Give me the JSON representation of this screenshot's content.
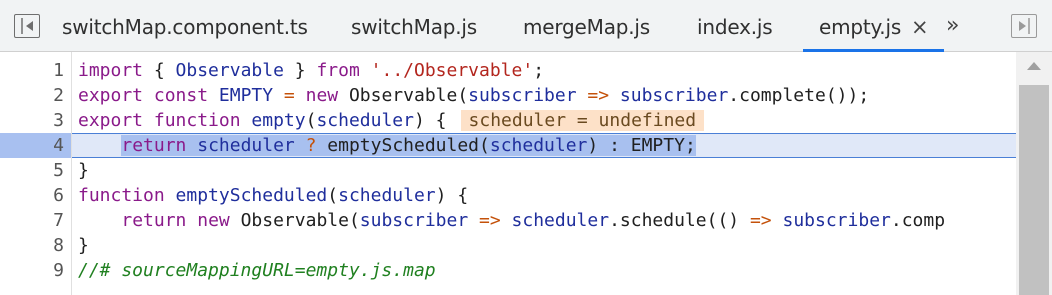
{
  "tabs": [
    {
      "label": "switchMap.component.ts",
      "active": false
    },
    {
      "label": "switchMap.js",
      "active": false
    },
    {
      "label": "mergeMap.js",
      "active": false
    },
    {
      "label": "index.js",
      "active": false
    },
    {
      "label": "empty.js",
      "active": true
    }
  ],
  "tab_close_glyph": "×",
  "more_tabs_glyph": "»",
  "icons": {
    "left_toggle": "toggle-navigator-icon",
    "right_toggle": "toggle-debugger-icon"
  },
  "colors": {
    "keyword": "#8a1a8a",
    "string": "#b3261e",
    "variable": "#1f2e9c",
    "comment": "#208020",
    "execution_line": "#e0e8f8",
    "accent": "#1a73e8"
  },
  "editor": {
    "line_numbers": [
      "1",
      "2",
      "3",
      "4",
      "5",
      "6",
      "7",
      "8",
      "9"
    ],
    "execution_line": 4,
    "lines": [
      [
        {
          "t": "import",
          "c": "k"
        },
        {
          "t": " { "
        },
        {
          "t": "Observable",
          "c": "v"
        },
        {
          "t": " } "
        },
        {
          "t": "from",
          "c": "k"
        },
        {
          "t": " "
        },
        {
          "t": "'../Observable'",
          "c": "s"
        },
        {
          "t": ";"
        }
      ],
      [
        {
          "t": "export",
          "c": "k"
        },
        {
          "t": " "
        },
        {
          "t": "const",
          "c": "k"
        },
        {
          "t": " "
        },
        {
          "t": "EMPTY",
          "c": "v"
        },
        {
          "t": " = ",
          "c": "o"
        },
        {
          "t": "new",
          "c": "k"
        },
        {
          "t": " Observable("
        },
        {
          "t": "subscriber",
          "c": "v"
        },
        {
          "t": " => ",
          "c": "o"
        },
        {
          "t": "subscriber",
          "c": "v"
        },
        {
          "t": ".complete());"
        }
      ],
      [
        {
          "t": "export",
          "c": "k"
        },
        {
          "t": " "
        },
        {
          "t": "function",
          "c": "k"
        },
        {
          "t": " "
        },
        {
          "t": "empty",
          "c": "v"
        },
        {
          "t": "("
        },
        {
          "t": "scheduler",
          "c": "v"
        },
        {
          "t": ") {"
        }
      ],
      [
        {
          "t": "    "
        },
        {
          "t": "return",
          "c": "k"
        },
        {
          "t": " "
        },
        {
          "t": "scheduler",
          "c": "v"
        },
        {
          "t": " ? ",
          "c": "o"
        },
        {
          "t": "emptyScheduled("
        },
        {
          "t": "scheduler",
          "c": "v"
        },
        {
          "t": ") : EMPTY;"
        }
      ],
      [
        {
          "t": "}"
        }
      ],
      [
        {
          "t": "function",
          "c": "k"
        },
        {
          "t": " "
        },
        {
          "t": "emptyScheduled",
          "c": "v"
        },
        {
          "t": "("
        },
        {
          "t": "scheduler",
          "c": "v"
        },
        {
          "t": ") {"
        }
      ],
      [
        {
          "t": "    "
        },
        {
          "t": "return",
          "c": "k"
        },
        {
          "t": " "
        },
        {
          "t": "new",
          "c": "k"
        },
        {
          "t": " Observable("
        },
        {
          "t": "subscriber",
          "c": "v"
        },
        {
          "t": " => ",
          "c": "o"
        },
        {
          "t": "scheduler",
          "c": "v"
        },
        {
          "t": ".schedule(() "
        },
        {
          "t": "=>",
          "c": "o"
        },
        {
          "t": " "
        },
        {
          "t": "subscriber",
          "c": "v"
        },
        {
          "t": ".comp"
        }
      ],
      [
        {
          "t": "}"
        }
      ],
      [
        {
          "t": "//# sourceMappingURL=empty.js.map",
          "c": "c"
        }
      ]
    ],
    "inline_value": "scheduler = undefined",
    "inline_value_line": 3
  }
}
